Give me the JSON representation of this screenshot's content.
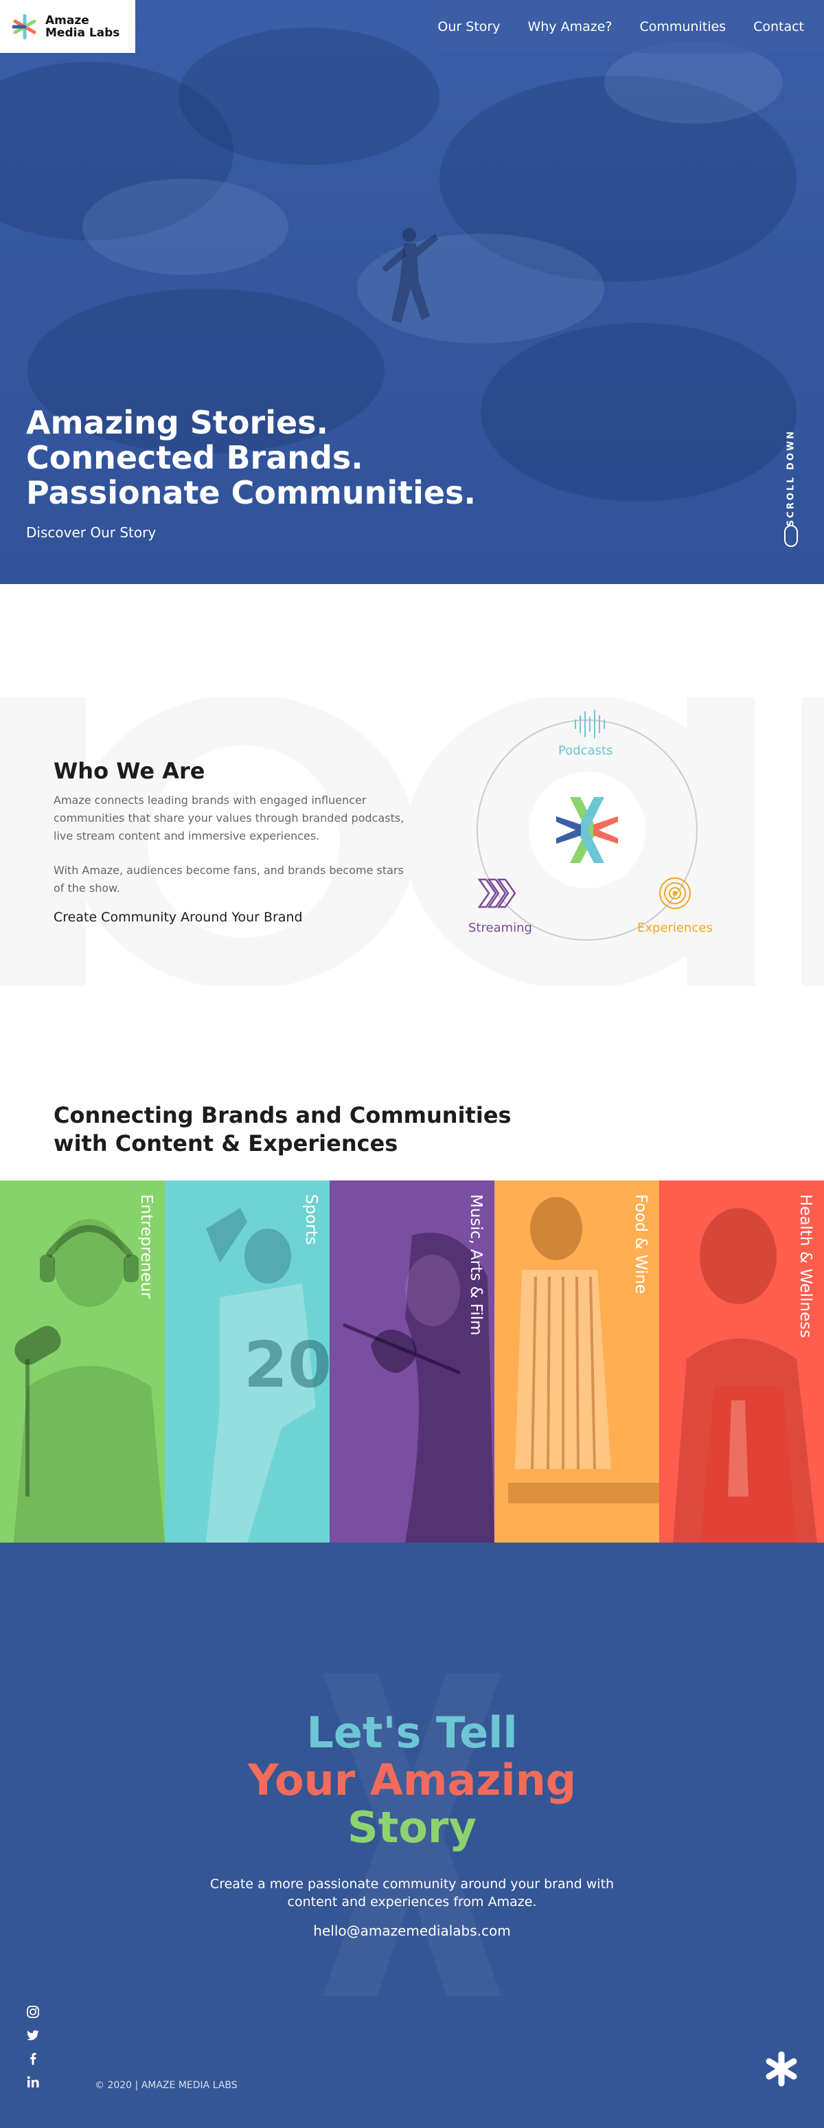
{
  "header": {
    "logo_line1": "Amaze",
    "logo_line2": "Media Labs",
    "nav": [
      "Our Story",
      "Why Amaze?",
      "Communities",
      "Contact"
    ]
  },
  "hero": {
    "headline": [
      "Amazing Stories.",
      "Connected Brands.",
      "Passionate Communities."
    ],
    "cta": "Discover Our Story",
    "scroll_label": "SCROLL DOWN",
    "overlay_color": "#3a5ea8"
  },
  "who": {
    "title": "Who We Are",
    "p1": "Amaze connects leading brands with engaged influencer communities that share your values through branded podcasts, live stream content and immersive experiences.",
    "p2": "With Amaze, audiences become fans, and brands become stars of the show.",
    "link": "Create Community Around Your Brand",
    "diagram": {
      "podcasts": "Podcasts",
      "streaming": "Streaming",
      "experiences": "Experiences",
      "colors": {
        "podcasts": "#6cc6d4",
        "streaming": "#7b4a9a",
        "experiences": "#f5a623"
      }
    }
  },
  "connect": {
    "title_line1": "Connecting Brands and Communities",
    "title_line2": "with Content & Experiences",
    "panels": [
      {
        "label": "Entrepreneur",
        "color": "#86d36a"
      },
      {
        "label": "Sports",
        "color": "#6fd3d3"
      },
      {
        "label": "Music, Arts & Film",
        "color": "#7a4ea0"
      },
      {
        "label": "Food & Wine",
        "color": "#ffae52"
      },
      {
        "label": "Health & Wellness",
        "color": "#ff5d4d"
      }
    ]
  },
  "contact": {
    "line1": "Let's Tell",
    "line2": "Your Amazing",
    "line3": "Story",
    "text": "Create a more passionate community around your brand with content and experiences from Amaze.",
    "email": "hello@amazemedialabs.com"
  },
  "footer": {
    "social": [
      "instagram-icon",
      "twitter-icon",
      "facebook-icon",
      "linkedin-icon"
    ],
    "copyright": "© 2020 | AMAZE MEDIA LABS"
  }
}
